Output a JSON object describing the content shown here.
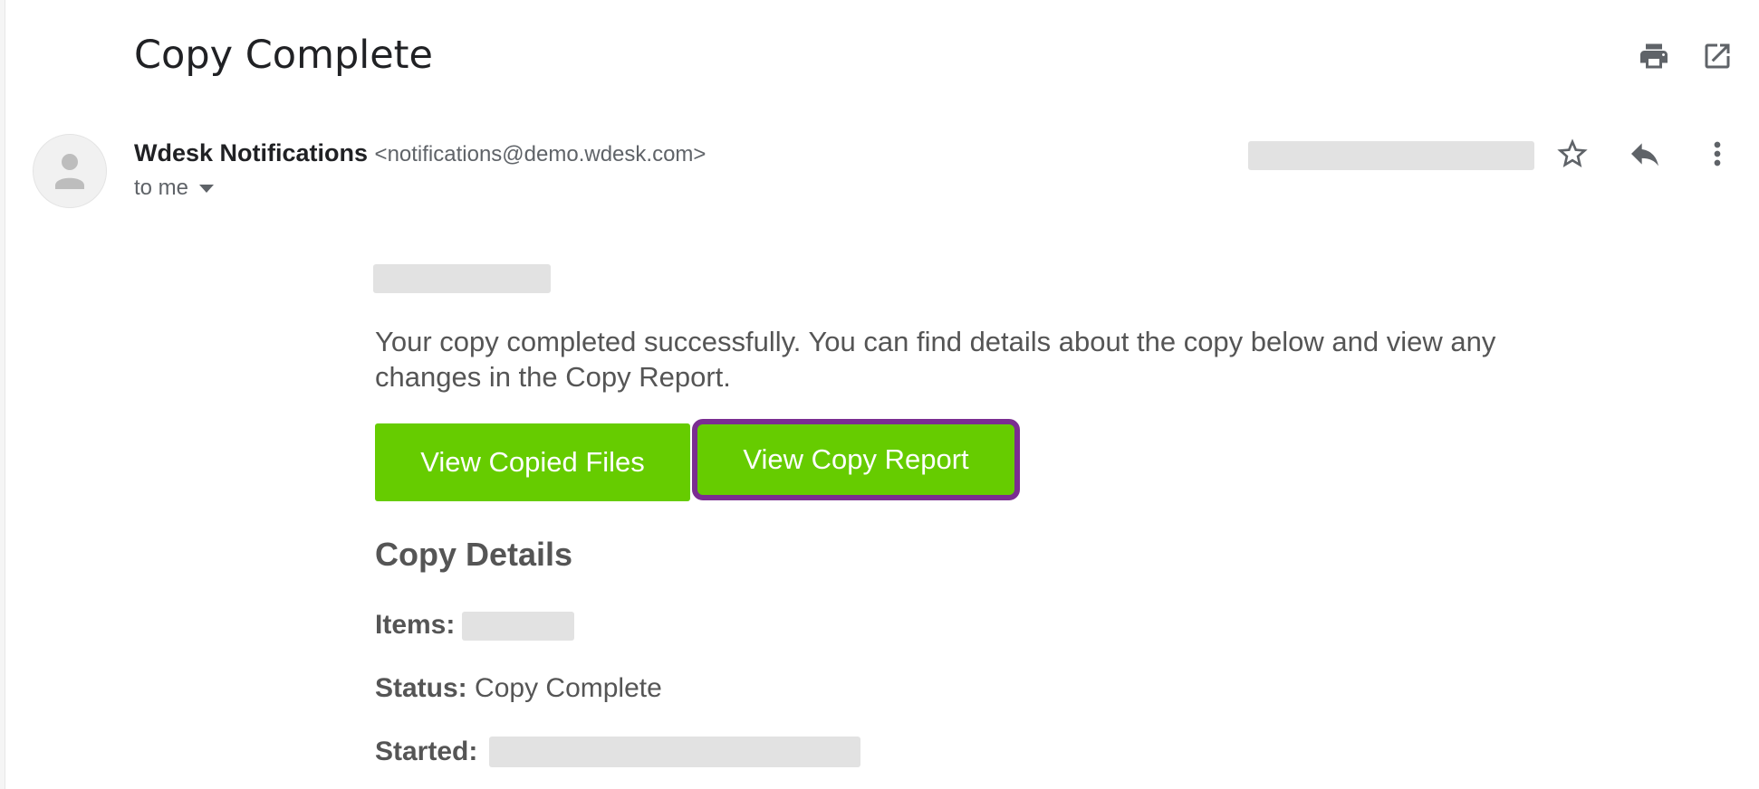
{
  "email": {
    "subject": "Copy Complete",
    "sender_name": "Wdesk Notifications",
    "sender_email": "<notifications@demo.wdesk.com>",
    "recipient_label": "to me"
  },
  "body": {
    "intro": "Your copy completed successfully. You can find details about the copy below and view any changes in the Copy Report.",
    "buttons": {
      "view_files": "View Copied Files",
      "view_report": "View Copy Report"
    },
    "details_heading": "Copy Details",
    "details": {
      "items_label": "Items:",
      "status_label": "Status:",
      "status_value": "Copy Complete",
      "started_label": "Started:"
    }
  },
  "icons": {
    "print": "print-icon",
    "open_new_window": "open-in-new-icon",
    "star": "star-icon",
    "reply": "reply-icon",
    "more": "more-vert-icon",
    "avatar": "person-icon"
  },
  "colors": {
    "button_green": "#66cc00",
    "focus_outline": "#7b2d91",
    "body_text": "#555555",
    "redaction": "#e2e2e2"
  }
}
